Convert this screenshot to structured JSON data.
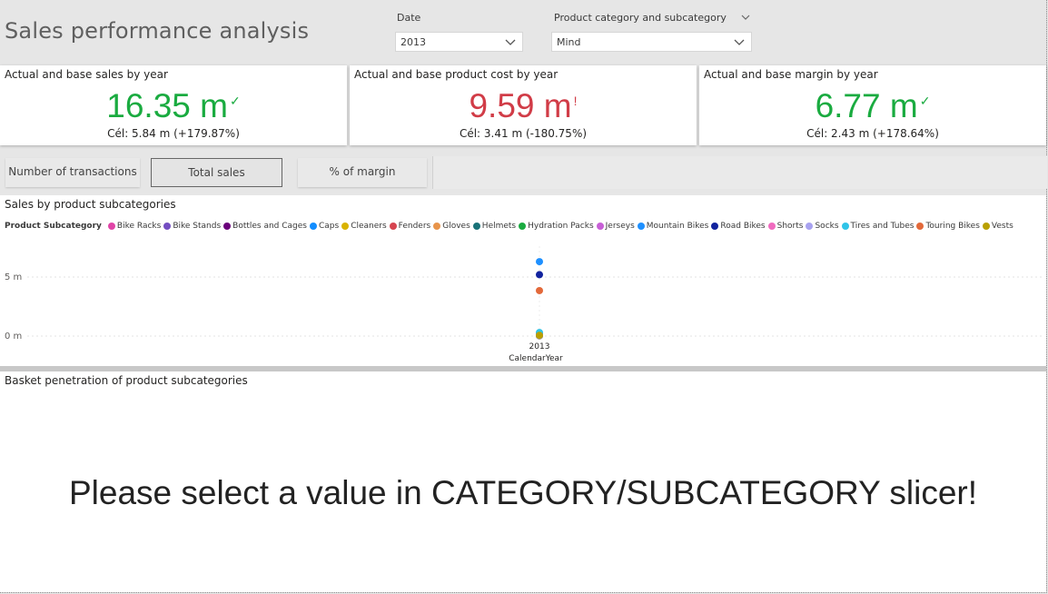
{
  "header": {
    "title": "Sales performance analysis",
    "date_slicer": {
      "label": "Date",
      "value": "2013"
    },
    "category_slicer": {
      "label": "Product category and subcategory",
      "value": "Mind"
    }
  },
  "kpis": [
    {
      "title": "Actual and base sales by year",
      "value": "16.35 m",
      "status_mark": "✓",
      "goal": "Cél: 5.84 m (+179.87%)",
      "color": "#1aab40"
    },
    {
      "title": "Actual and base product cost by year",
      "value": "9.59 m",
      "status_mark": "!",
      "goal": "Cél: 3.41 m (-180.75%)",
      "color": "#d13c47"
    },
    {
      "title": "Actual and base margin by year",
      "value": "6.77 m",
      "status_mark": "✓",
      "goal": "Cél: 2.43 m (+178.64%)",
      "color": "#1aab40"
    }
  ],
  "tabs": [
    {
      "label": "Number of transactions",
      "active": false
    },
    {
      "label": "Total sales",
      "active": true
    },
    {
      "label": "% of margin",
      "active": false
    }
  ],
  "sales_chart": {
    "title": "Sales by product subcategories",
    "legend_title": "Product Subcategory",
    "xlabel": "CalendarYear",
    "ytick_labels": [
      "5 m",
      "0 m"
    ]
  },
  "chart_data": {
    "type": "scatter",
    "x": [
      "2013"
    ],
    "ylim": [
      0,
      7000000
    ],
    "yticks": [
      0,
      5000000
    ],
    "grid": true,
    "legend_position": "top-left",
    "series": [
      {
        "name": "Bike Racks",
        "color": "#e044a7",
        "values": [
          30000
        ]
      },
      {
        "name": "Bike Stands",
        "color": "#744ec2",
        "values": [
          25000
        ]
      },
      {
        "name": "Bottles and Cages",
        "color": "#6b007b",
        "values": [
          40000
        ]
      },
      {
        "name": "Caps",
        "color": "#118dff",
        "values": [
          20000
        ]
      },
      {
        "name": "Cleaners",
        "color": "#d9b300",
        "values": [
          10000
        ]
      },
      {
        "name": "Fenders",
        "color": "#d64550",
        "values": [
          45000
        ]
      },
      {
        "name": "Gloves",
        "color": "#e8944a",
        "values": [
          130000
        ]
      },
      {
        "name": "Helmets",
        "color": "#197278",
        "values": [
          220000
        ]
      },
      {
        "name": "Hydration Packs",
        "color": "#1aab40",
        "values": [
          50000
        ]
      },
      {
        "name": "Jerseys",
        "color": "#c75fd6",
        "values": [
          200000
        ]
      },
      {
        "name": "Mountain Bikes",
        "color": "#1e90ff",
        "values": [
          6300000
        ]
      },
      {
        "name": "Road Bikes",
        "color": "#12239e",
        "values": [
          5200000
        ]
      },
      {
        "name": "Shorts",
        "color": "#f06bbf",
        "values": [
          100000
        ]
      },
      {
        "name": "Socks",
        "color": "#a8a2f0",
        "values": [
          15000
        ]
      },
      {
        "name": "Tires and Tubes",
        "color": "#2fc4e8",
        "values": [
          300000
        ]
      },
      {
        "name": "Touring Bikes",
        "color": "#e3693a",
        "values": [
          3850000
        ]
      },
      {
        "name": "Vests",
        "color": "#b9a000",
        "values": [
          60000
        ]
      }
    ]
  },
  "basket": {
    "title": "Basket penetration of product subcategories",
    "message": "Please select a value in CATEGORY/SUBCATEGORY slicer!"
  }
}
